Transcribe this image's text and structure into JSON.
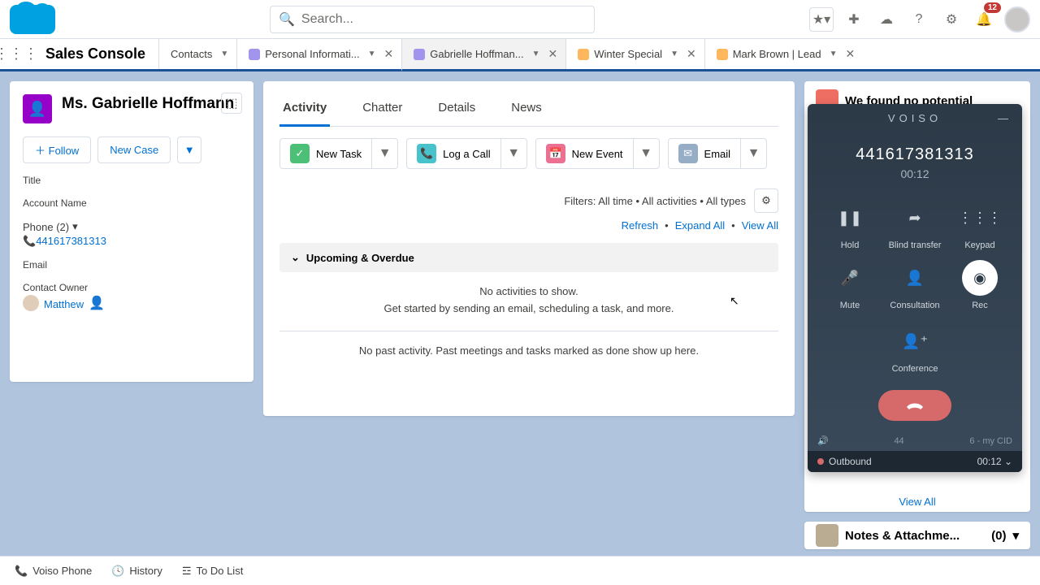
{
  "header": {
    "search_placeholder": "Search...",
    "notification_count": "12"
  },
  "navbar": {
    "app_name": "Sales Console",
    "tabs": [
      {
        "label": "Contacts"
      },
      {
        "label": "Personal Informati..."
      },
      {
        "label": "Gabrielle Hoffman..."
      },
      {
        "label": "Winter Special"
      },
      {
        "label": "Mark Brown | Lead"
      }
    ]
  },
  "contact": {
    "name": "Ms. Gabrielle Hoffmann",
    "follow": "Follow",
    "new_case": "New Case",
    "title_label": "Title",
    "account_label": "Account Name",
    "phone_label": "Phone (2)",
    "phone_value": "441617381313",
    "email_label": "Email",
    "owner_label": "Contact Owner",
    "owner_value": "Matthew"
  },
  "center": {
    "tabs": {
      "activity": "Activity",
      "chatter": "Chatter",
      "details": "Details",
      "news": "News"
    },
    "actions": {
      "new_task": "New Task",
      "log_call": "Log a Call",
      "new_event": "New Event",
      "email": "Email"
    },
    "filters": "Filters: All time • All activities • All types",
    "links": {
      "refresh": "Refresh",
      "expand": "Expand All",
      "view_all": "View All"
    },
    "section": "Upcoming & Overdue",
    "empty1": "No activities to show.",
    "empty2": "Get started by sending an email, scheduling a task, and more.",
    "past": "No past activity. Past meetings and tasks marked as done show up here."
  },
  "right": {
    "potential": "We found no potential",
    "view_all": "View All",
    "notes": "Notes & Attachme...",
    "notes_count": "(0)"
  },
  "voiso": {
    "brand": "VOISO",
    "number": "441617381313",
    "timer": "00:12",
    "buttons": {
      "hold": "Hold",
      "blind": "Blind transfer",
      "keypad": "Keypad",
      "mute": "Mute",
      "consult": "Consultation",
      "rec": "Rec",
      "conf": "Conference"
    },
    "footer_left": "44",
    "footer_right": "6 - my CID",
    "status": "Outbound",
    "status_time": "00:12"
  },
  "utilbar": {
    "voiso": "Voiso Phone",
    "history": "History",
    "todo": "To Do List"
  }
}
